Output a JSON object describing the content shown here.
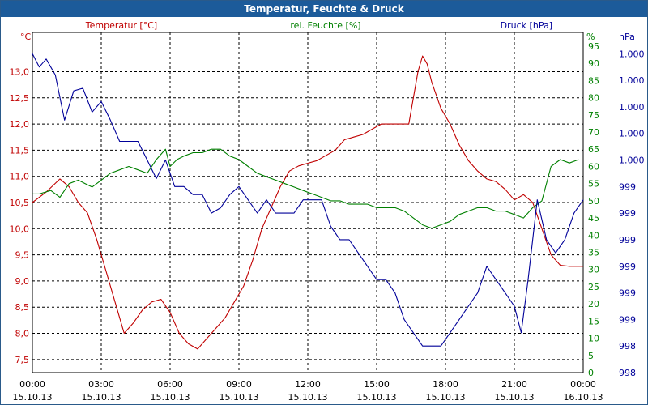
{
  "title": "Temperatur, Feuchte & Druck",
  "colors": {
    "temperature": "#c00000",
    "humidity": "#008000",
    "pressure": "#000099",
    "grid": "#000000",
    "title_bg": "#1c5b9a"
  },
  "chart_data": {
    "type": "line",
    "title": "Temperatur, Feuchte & Druck",
    "x_ticks": [
      {
        "t": "00:00",
        "d": "15.10.13"
      },
      {
        "t": "03:00",
        "d": "15.10.13"
      },
      {
        "t": "06:00",
        "d": "15.10.13"
      },
      {
        "t": "09:00",
        "d": "15.10.13"
      },
      {
        "t": "12:00",
        "d": "15.10.13"
      },
      {
        "t": "15:00",
        "d": "15.10.13"
      },
      {
        "t": "18:00",
        "d": "15.10.13"
      },
      {
        "t": "21:00",
        "d": "15.10.13"
      },
      {
        "t": "00:00",
        "d": "16.10.13"
      }
    ],
    "axes": {
      "temperature": {
        "label": "Temperatur [°C]",
        "unit": "°C",
        "range": [
          7.25,
          13.75
        ],
        "ticks": [
          13.0,
          12.5,
          12.0,
          11.5,
          11.0,
          10.5,
          10.0,
          9.5,
          9.0,
          8.5,
          8.0,
          7.5
        ],
        "tick_labels": [
          "13,0",
          "12,5",
          "12,0",
          "11,5",
          "11,0",
          "10,5",
          "10,0",
          "9,5",
          "9,0",
          "8,5",
          "8,0",
          "7,5"
        ]
      },
      "humidity": {
        "label": "rel. Feuchte [%]",
        "unit": "%",
        "range": [
          0,
          99
        ],
        "ticks": [
          95,
          90,
          85,
          80,
          75,
          70,
          65,
          60,
          55,
          50,
          45,
          40,
          35,
          30,
          25,
          20,
          15,
          10,
          5,
          0
        ],
        "tick_labels": [
          "95",
          "90",
          "85",
          "80",
          "75",
          "70",
          "65",
          "60",
          "55",
          "50",
          "45",
          "40",
          "35",
          "30",
          "25",
          "20",
          "15",
          "10",
          "5",
          "0"
        ]
      },
      "pressure": {
        "label": "Druck [hPa]",
        "unit": "hPa",
        "range": [
          0,
          12.8
        ],
        "ticks": [
          12,
          11,
          10,
          9,
          8,
          7,
          6,
          5,
          4,
          3,
          2,
          1,
          0
        ],
        "tick_labels": [
          "1.000",
          "1.000",
          "1.000",
          "1.000",
          "1.000",
          "999",
          "999",
          "999",
          "999",
          "999",
          "999",
          "998",
          "998"
        ]
      }
    },
    "series": [
      {
        "name": "Temperatur [°C]",
        "axis": "temperature",
        "x": [
          0,
          0.6,
          1.2,
          1.6,
          2.0,
          2.4,
          2.8,
          3.2,
          3.6,
          4.0,
          4.4,
          4.8,
          5.2,
          5.6,
          6.0,
          6.4,
          6.8,
          7.2,
          7.6,
          8.0,
          8.4,
          8.8,
          9.2,
          9.6,
          10.0,
          10.4,
          10.8,
          11.2,
          11.6,
          12.0,
          12.4,
          12.8,
          13.2,
          13.6,
          14.0,
          14.4,
          14.8,
          15.2,
          15.6,
          16.0,
          16.4,
          16.8,
          17.0,
          17.2,
          17.4,
          17.8,
          18.2,
          18.6,
          19.0,
          19.4,
          19.8,
          20.2,
          20.6,
          21.0,
          21.4,
          21.8,
          22.2,
          22.6,
          23.0,
          23.4,
          24.0
        ],
        "values": [
          10.5,
          10.7,
          10.95,
          10.8,
          10.5,
          10.3,
          9.8,
          9.2,
          8.6,
          8.0,
          8.2,
          8.45,
          8.6,
          8.65,
          8.4,
          8.0,
          7.8,
          7.7,
          7.9,
          8.1,
          8.3,
          8.6,
          8.9,
          9.4,
          10.0,
          10.4,
          10.8,
          11.1,
          11.2,
          11.25,
          11.3,
          11.4,
          11.5,
          11.7,
          11.75,
          11.8,
          11.9,
          12.0,
          12.0,
          12.0,
          12.0,
          13.0,
          13.3,
          13.15,
          12.8,
          12.3,
          12.0,
          11.6,
          11.3,
          11.1,
          10.95,
          10.9,
          10.75,
          10.55,
          10.65,
          10.5,
          10.0,
          9.5,
          9.3,
          9.28,
          9.28
        ]
      },
      {
        "name": "rel. Feuchte [%]",
        "axis": "humidity",
        "x": [
          0,
          0.3,
          0.8,
          1.2,
          1.6,
          2.0,
          2.3,
          2.6,
          3.0,
          3.4,
          3.8,
          4.2,
          4.6,
          5.0,
          5.4,
          5.8,
          6.0,
          6.3,
          6.6,
          7.0,
          7.4,
          7.8,
          8.2,
          8.6,
          9.0,
          9.4,
          9.8,
          10.2,
          10.6,
          11.0,
          11.4,
          11.8,
          12.2,
          12.6,
          13.0,
          13.4,
          13.8,
          14.2,
          14.6,
          15.0,
          15.4,
          15.8,
          16.2,
          16.6,
          17.0,
          17.4,
          17.8,
          18.2,
          18.6,
          19.0,
          19.4,
          19.8,
          20.2,
          20.6,
          21.0,
          21.4,
          21.8,
          22.2,
          22.6,
          23.0,
          23.4,
          23.8
        ],
        "values": [
          52,
          52,
          53,
          51,
          55,
          56,
          55,
          54,
          56,
          58,
          59,
          60,
          59,
          58,
          62,
          65,
          60,
          62,
          63,
          64,
          64,
          65,
          65,
          63,
          62,
          60,
          58,
          57,
          56,
          55,
          54,
          53,
          52,
          51,
          50,
          50,
          49,
          49,
          49,
          48,
          48,
          48,
          47,
          45,
          43,
          42,
          43,
          44,
          46,
          47,
          48,
          48,
          47,
          47,
          46,
          45,
          48,
          50,
          60,
          62,
          61,
          62
        ]
      },
      {
        "name": "Druck [hPa]",
        "axis": "pressure",
        "x": [
          0,
          0.3,
          0.6,
          1.0,
          1.4,
          1.8,
          2.2,
          2.6,
          3.0,
          3.4,
          3.8,
          4.2,
          4.6,
          5.0,
          5.4,
          5.8,
          6.2,
          6.6,
          7.0,
          7.4,
          7.8,
          8.2,
          8.6,
          9.0,
          9.4,
          9.8,
          10.2,
          10.6,
          11.0,
          11.4,
          11.8,
          12.2,
          12.6,
          13.0,
          13.4,
          13.8,
          14.2,
          14.6,
          15.0,
          15.4,
          15.8,
          16.2,
          16.6,
          17.0,
          17.4,
          17.8,
          18.2,
          18.6,
          19.0,
          19.4,
          19.8,
          20.2,
          20.6,
          21.0,
          21.3,
          21.6,
          22.0,
          22.4,
          22.8,
          23.2,
          23.6,
          24.0
        ],
        "values": [
          12.0,
          11.5,
          11.8,
          11.2,
          9.5,
          10.6,
          10.7,
          9.8,
          10.2,
          9.5,
          8.7,
          8.7,
          8.7,
          8.0,
          7.3,
          8.0,
          7.0,
          7.0,
          6.7,
          6.7,
          6.0,
          6.2,
          6.7,
          7.0,
          6.5,
          6.0,
          6.5,
          6.0,
          6.0,
          6.0,
          6.5,
          6.5,
          6.5,
          5.5,
          5.0,
          5.0,
          4.5,
          4.0,
          3.5,
          3.5,
          3.0,
          2.0,
          1.5,
          1.0,
          1.0,
          1.0,
          1.5,
          2.0,
          2.5,
          3.0,
          4.0,
          3.5,
          3.0,
          2.5,
          1.5,
          3.5,
          6.5,
          5.0,
          4.5,
          5.0,
          6.0,
          6.5
        ]
      }
    ]
  }
}
